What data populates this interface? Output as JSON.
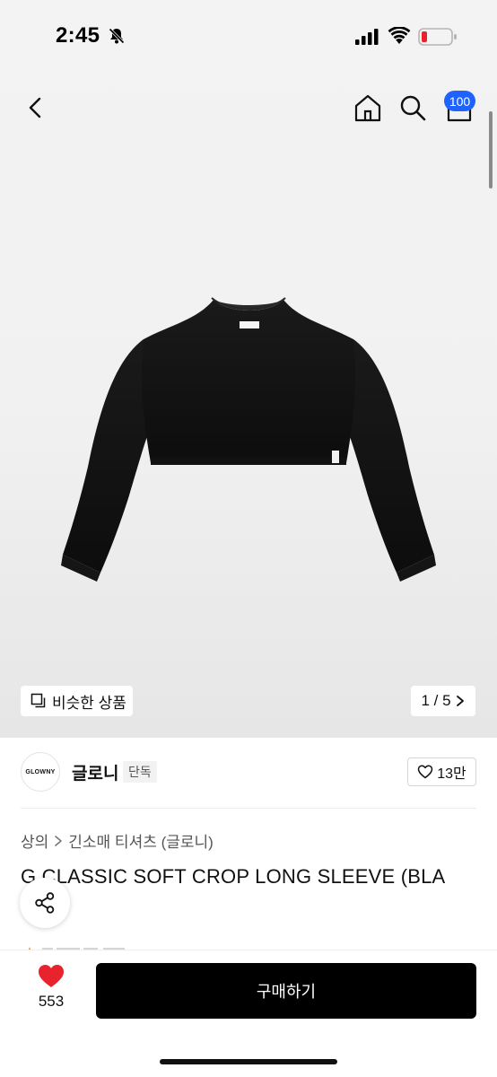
{
  "status_bar": {
    "time": "2:45"
  },
  "header": {
    "cart_count": "100"
  },
  "gallery": {
    "similar_label": "비슷한 상품",
    "page_indicator": "1 / 5",
    "label_on_garment": "GLOWNY"
  },
  "brand": {
    "logo_text": "GLOWNY",
    "name": "글로니",
    "badge": "단독",
    "like_count": "13만"
  },
  "breadcrumb": {
    "category": "상의",
    "sub_category": "긴소매 티셔츠 (글로니)"
  },
  "product": {
    "title": "G CLASSIC SOFT CROP LONG SLEEVE (BLA"
  },
  "bottom_bar": {
    "like_count": "553",
    "buy_label": "구매하기"
  },
  "colors": {
    "accent_badge": "#1e63ff",
    "like_heart": "#e8232e",
    "buy_button": "#000000"
  },
  "icons": [
    "bell-slash-icon",
    "signal-icon",
    "wifi-icon",
    "battery-icon",
    "back-icon",
    "home-icon",
    "search-icon",
    "cart-icon",
    "similar-icon",
    "chevron-right-icon",
    "heart-outline-icon",
    "share-icon",
    "heart-filled-icon"
  ]
}
